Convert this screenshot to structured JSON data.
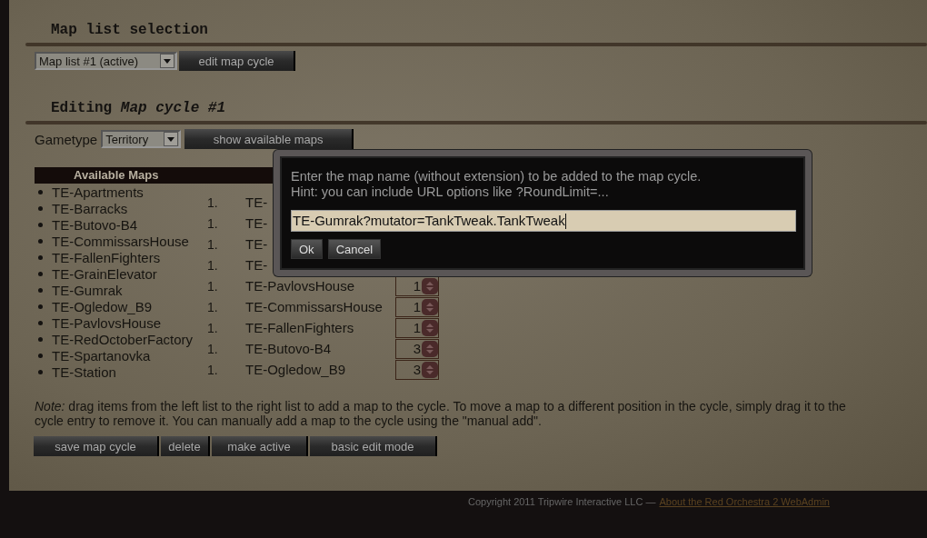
{
  "map_list_selection": {
    "heading": "Map list selection",
    "select_value": "Map list #1 (active)",
    "button": "edit map cycle"
  },
  "editing": {
    "heading": "Editing *Map cycle #1*",
    "gametype_label": "Gametype",
    "gametype_value": "Territory",
    "button": "show available maps"
  },
  "available_maps": {
    "title": "Available Maps",
    "items": [
      "TE-Apartments",
      "TE-Barracks",
      "TE-Butovo-B4",
      "TE-CommissarsHouse",
      "TE-FallenFighters",
      "TE-GrainElevator",
      "TE-Gumrak",
      "TE-Ogledow_B9",
      "TE-PavlovsHouse",
      "TE-RedOctoberFactory",
      "TE-Spartanovka",
      "TE-Station"
    ]
  },
  "map_cycle": [
    {
      "number": "1.",
      "name": "TE-"
    },
    {
      "number": "1.",
      "name": "TE-"
    },
    {
      "number": "1.",
      "name": "TE-"
    },
    {
      "number": "1.",
      "name": "TE-"
    },
    {
      "number": "1.",
      "name": "TE-PavlovsHouse",
      "rounds": "1"
    },
    {
      "number": "1.",
      "name": "TE-CommissarsHouse",
      "rounds": "1"
    },
    {
      "number": "1.",
      "name": "TE-FallenFighters",
      "rounds": "1"
    },
    {
      "number": "1.",
      "name": "TE-Butovo-B4",
      "rounds": "3"
    },
    {
      "number": "1.",
      "name": "TE-Ogledow_B9",
      "rounds": "3"
    }
  ],
  "note_lines": [
    "*Note:* drag items from the left list to the right list to add a map to the cycle. To move a map to a different position in the cycle, simply drag it to the",
    "cycle entry to remove it. You can manually add a map to the cycle using the \"manual add\"."
  ],
  "actions": [
    "save map cycle",
    "delete",
    "make active",
    "basic edit mode"
  ],
  "dialog": {
    "message_lines": [
      "Enter the map name (without extension) to be added to the map cycle.",
      "Hint: you can include URL options like ?RoundLimit=..."
    ],
    "input_value": "TE-Gumrak?mutator=TankTweak.TankTweak",
    "buttons": [
      "Ok",
      "Cancel"
    ]
  },
  "footer": {
    "copyright": "Copyright 2011 Tripwire Interactive LLC —",
    "link": "About the Red Orchestra 2 WebAdmin"
  }
}
